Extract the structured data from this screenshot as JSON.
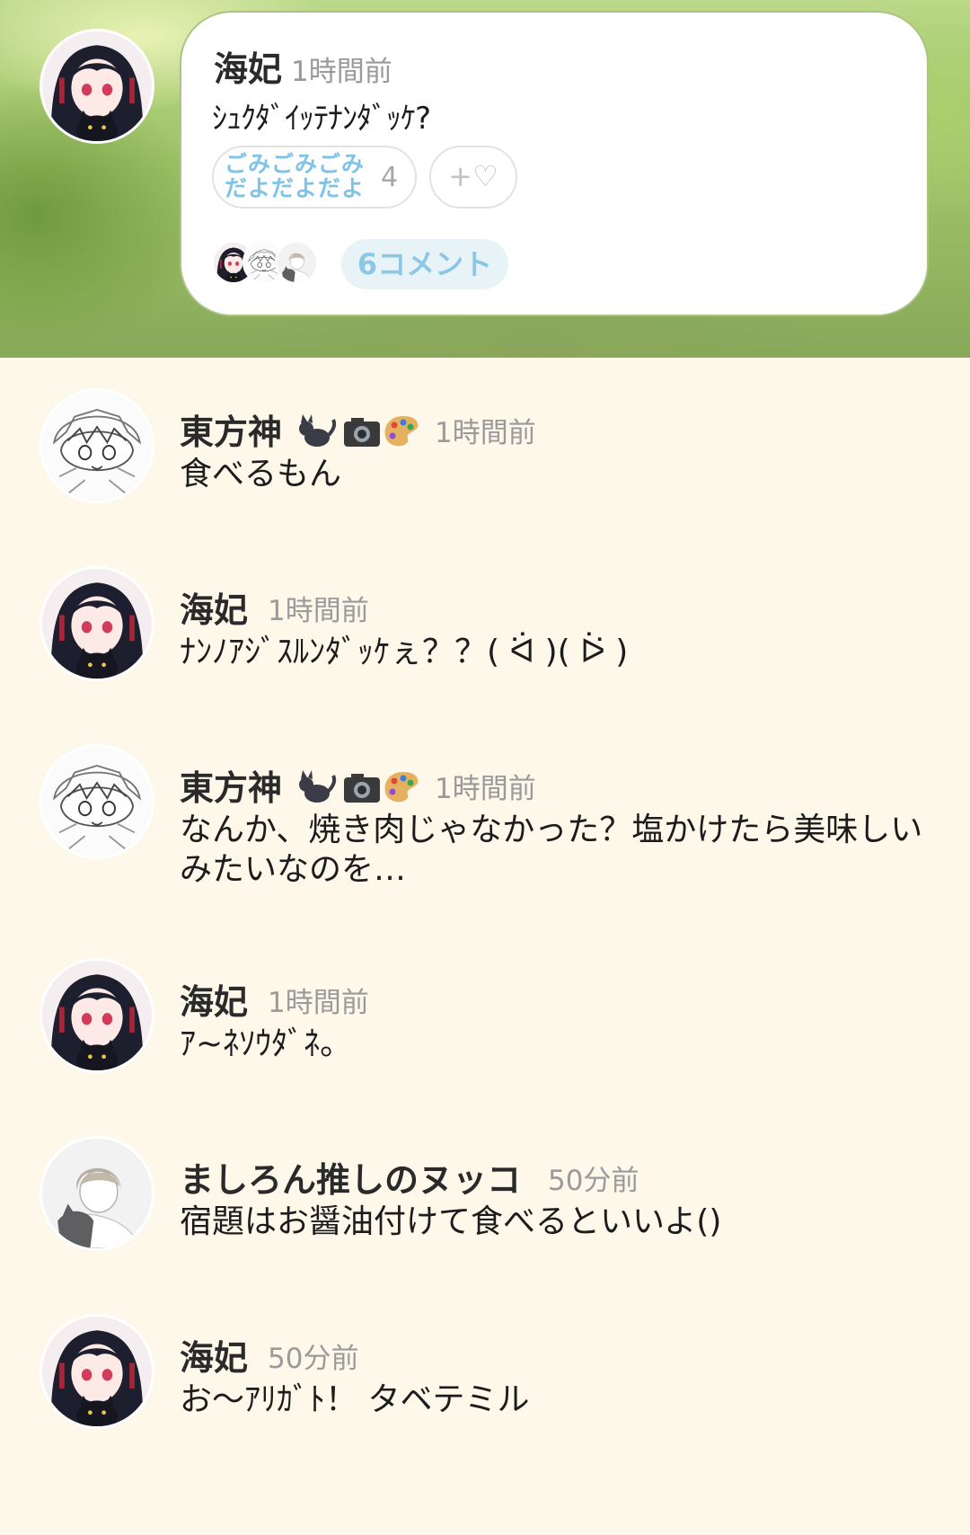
{
  "post": {
    "author": "海妃",
    "time": "1時間前",
    "text": "ｼｭｸﾀﾞｲｯﾃﾅﾝﾀﾞｯｹ?",
    "reaction_stamp_text": "ごみごみごみだよだよだよ",
    "reaction_count": "4",
    "add_reaction_label": "+♡",
    "comment_count_label": "6コメント"
  },
  "comments": [
    {
      "author": "東方神",
      "time": "1時間前",
      "text": "食べるもん"
    },
    {
      "author": "海妃",
      "time": "1時間前",
      "text": "ﾅﾝﾉｱｼﾞｽﾙﾝﾀﾞｯｹぇ？？( ᐛ )( ᐖ )"
    },
    {
      "author": "東方神",
      "time": "1時間前",
      "text": "なんか、焼き肉じゃなかった？塩かけたら美味しいみたいなのを…"
    },
    {
      "author": "海妃",
      "time": "1時間前",
      "text": "ｱ~ﾈｿｳﾀﾞﾈ。"
    },
    {
      "author": "ましろん推しのヌッコ",
      "time": "50分前",
      "text": "宿題はお醤油付けて食べるといいよ()"
    },
    {
      "author": "海妃",
      "time": "50分前",
      "text": "お〜ｱﾘｶﾞﾄ！ タベテミル"
    }
  ],
  "colors": {
    "background": "#fdf8ea",
    "accent_blue": "#8cc8e6",
    "muted_text": "#9a9a9a"
  }
}
